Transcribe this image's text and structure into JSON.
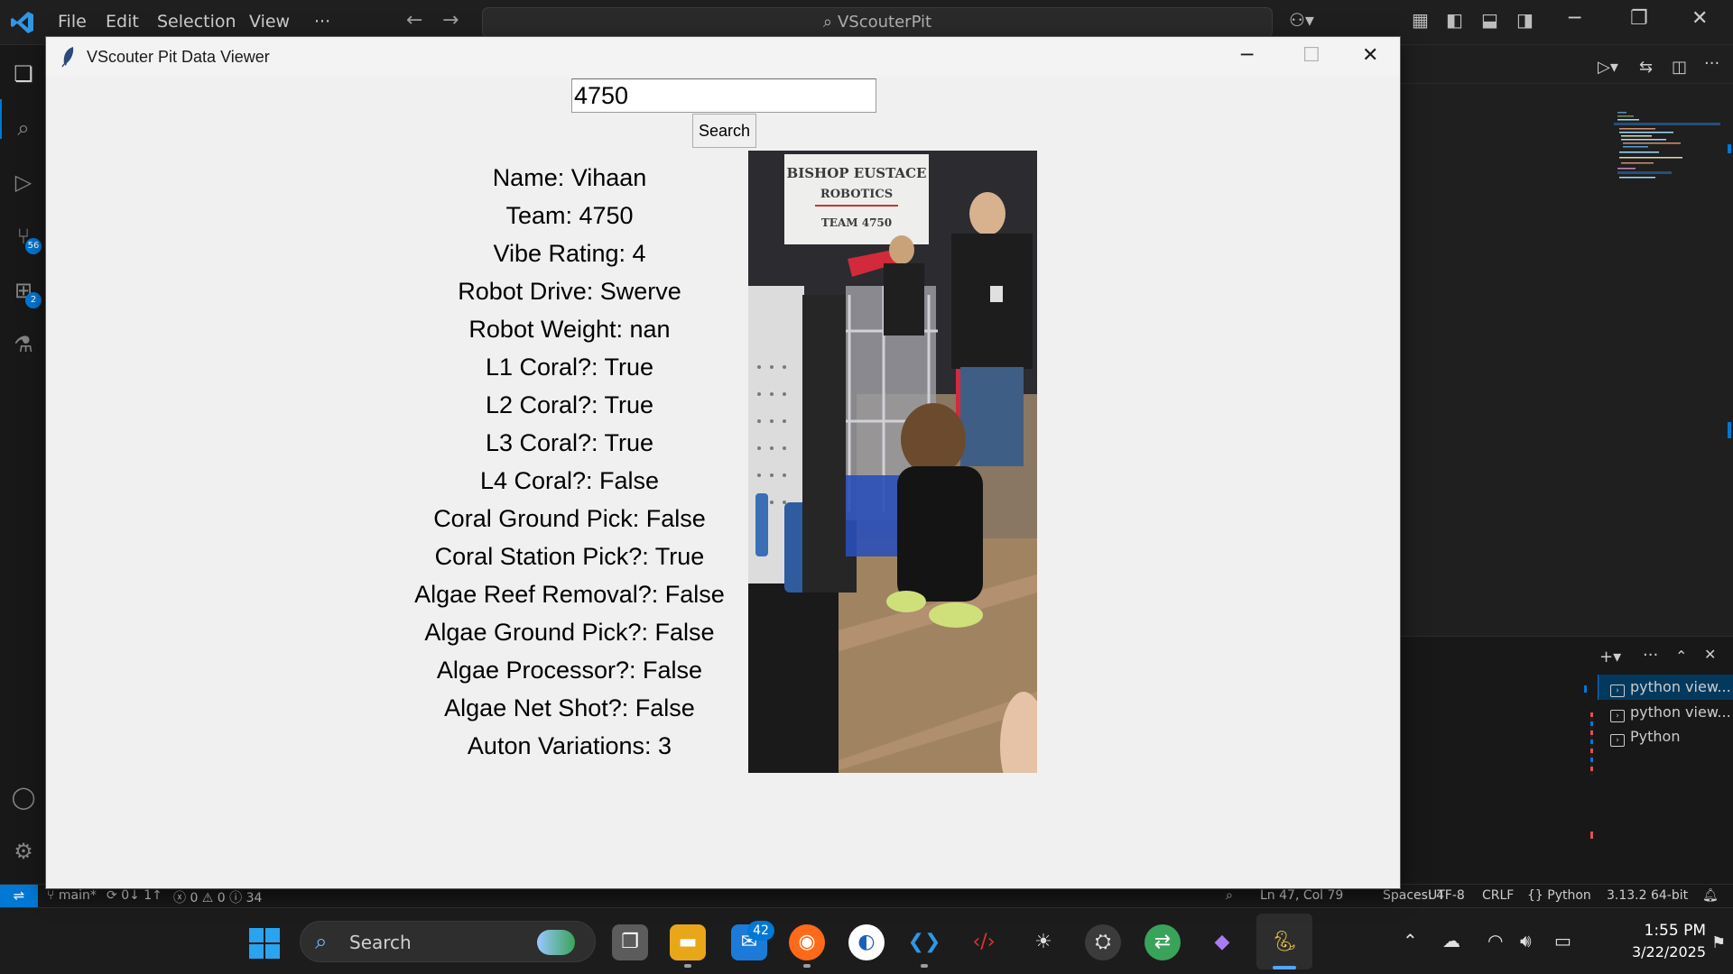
{
  "vscode": {
    "menu": [
      "File",
      "Edit",
      "Selection",
      "View",
      "···"
    ],
    "command_center": "VScouterPit",
    "activity_badges": {
      "source_control": "56",
      "extensions": "2"
    },
    "terminals": [
      "python view...",
      "python view...",
      "Python"
    ],
    "statusbar": {
      "branch": "main*",
      "sync": "0↓ 1↑",
      "problems": "ⓧ 0 ⚠ 0 ⓘ 34",
      "position": "Ln 47, Col 79",
      "spaces": "Spaces: 4",
      "encoding": "UTF-8",
      "eol": "CRLF",
      "language": "{} Python",
      "interpreter": "3.13.2 64-bit"
    }
  },
  "app": {
    "title": "VScouter Pit Data Viewer",
    "search_value": "4750",
    "search_button": "Search",
    "fields": [
      "Name: Vihaan",
      "Team: 4750",
      "Vibe Rating: 4",
      "Robot Drive: Swerve",
      "Robot Weight: nan",
      "L1 Coral?: True",
      "L2 Coral?: True",
      "L3 Coral?: True",
      "L4 Coral?: False",
      "Coral Ground Pick: False",
      "Coral Station Pick?: True",
      "Algae Reef Removal?: False",
      "Algae Ground Pick?: False",
      "Algae Processor?: False",
      "Algae Net Shot?: False",
      "Auton Variations: 3"
    ],
    "photo_banner": [
      "BISHOP EUSTACE",
      "ROBOTICS",
      "TEAM 4750"
    ]
  },
  "taskbar": {
    "search_label": "Search",
    "mail_badge": "42",
    "time": "1:55 PM",
    "date": "3/22/2025"
  }
}
